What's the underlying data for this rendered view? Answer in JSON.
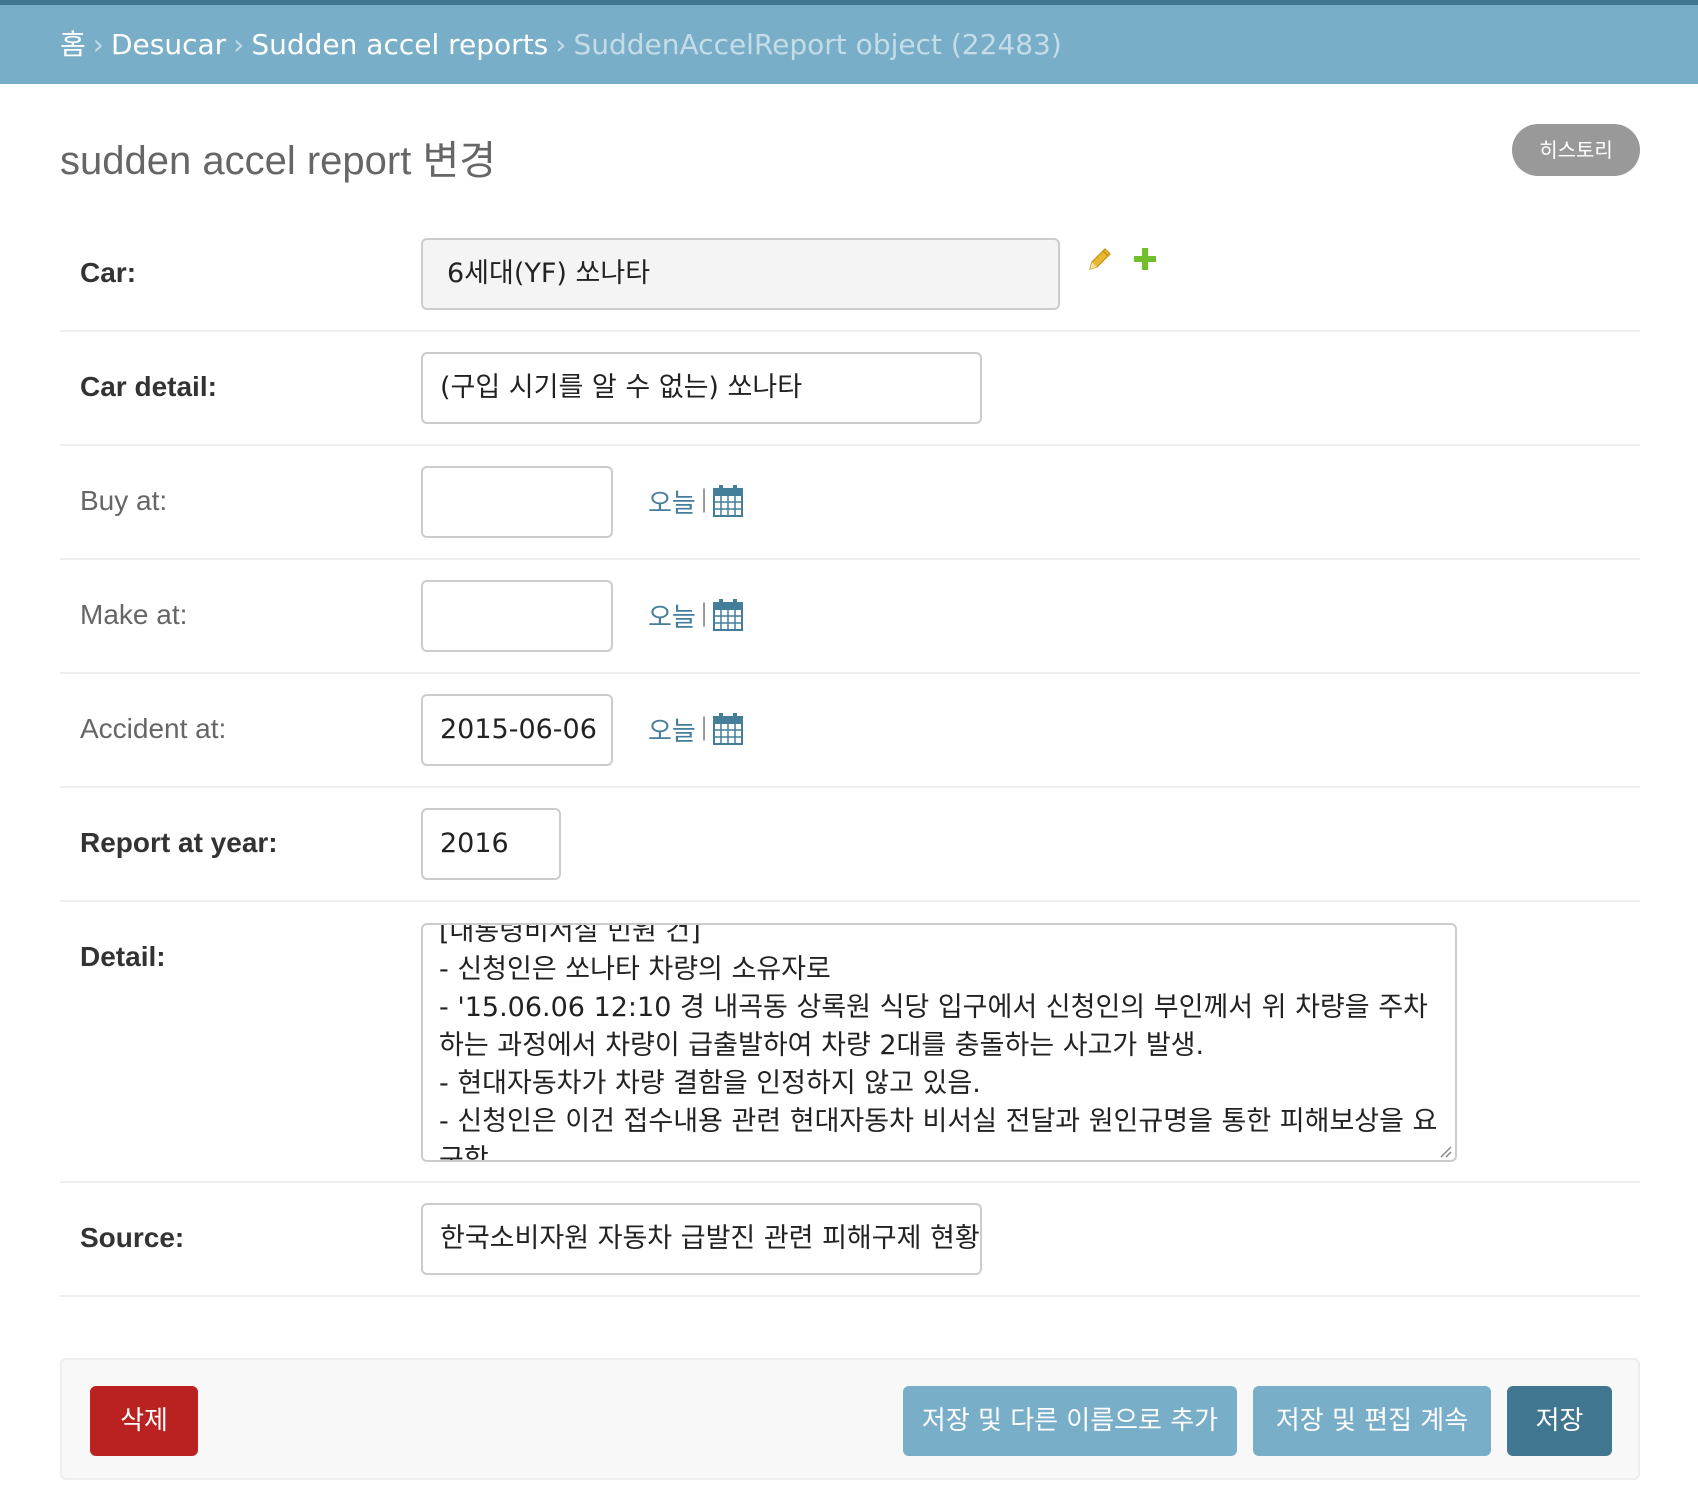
{
  "breadcrumbs": {
    "home": "홈",
    "app": "Desucar",
    "model": "Sudden accel reports",
    "current": "SuddenAccelReport object (22483)",
    "separator": "›"
  },
  "header": {
    "title": "sudden accel report 변경",
    "history_button": "히스토리"
  },
  "form": {
    "car": {
      "label": "Car:",
      "value": "6세대(YF) 쏘나타"
    },
    "car_detail": {
      "label": "Car detail:",
      "value": "(구입 시기를 알 수 없는) 쏘나타"
    },
    "buy_at": {
      "label": "Buy at:",
      "value": "",
      "today": "오늘"
    },
    "make_at": {
      "label": "Make at:",
      "value": "",
      "today": "오늘"
    },
    "accident_at": {
      "label": "Accident at:",
      "value": "2015-06-06",
      "today": "오늘"
    },
    "report_at_year": {
      "label": "Report at year:",
      "value": "2016"
    },
    "detail": {
      "label": "Detail:",
      "value": "[대통령비서실 민원 건]\n- 신청인은 쏘나타 차량의 소유자로\n- '15.06.06 12:10 경 내곡동 상록원 식당 입구에서 신청인의 부인께서 위 차량을 주차하는 과정에서 차량이 급출발하여 차량 2대를 충돌하는 사고가 발생.\n- 현대자동차가 차량 결함을 인정하지 않고 있음.\n- 신청인은 이건 접수내용 관련 현대자동차 비서실 전달과 원인규명을 통한 피해보상을 요구함."
    },
    "source": {
      "label": "Source:",
      "value": "한국소비자원 자동차 급발진 관련 피해구제 현황"
    }
  },
  "buttons": {
    "delete": "삭제",
    "save_as_new": "저장 및 다른 이름으로 추가",
    "save_continue": "저장 및 편집 계속",
    "save": "저장"
  },
  "colors": {
    "header_bg": "#79aec8",
    "header_line": "#417690",
    "link": "#447e9b",
    "delete": "#ba2121",
    "primary": "#417690",
    "secondary": "#79aec8"
  },
  "icons": [
    "pencil-icon",
    "plus-icon",
    "calendar-icon"
  ]
}
